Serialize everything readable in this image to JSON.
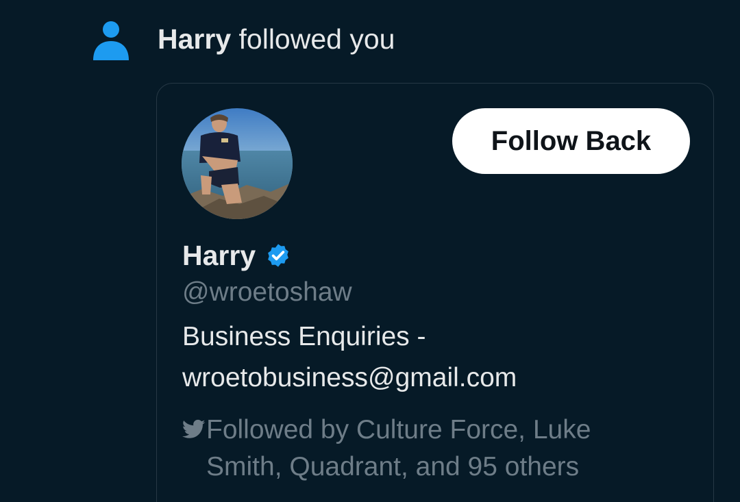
{
  "notification": {
    "actor_name": "Harry",
    "action_text": " followed you",
    "icon": "person-icon"
  },
  "user_card": {
    "display_name": "Harry",
    "verified_icon": "verified-badge-icon",
    "handle": "@wroetoshaw",
    "bio_line1": "Business Enquiries -",
    "bio_line2": "wroetobusiness@gmail.com",
    "follow_button_label": "Follow Back",
    "followed_by_line1": "Followed by Culture Force, Luke",
    "followed_by_line2": "Smith, Quadrant, and 95 others",
    "followed_by_icon": "bird-icon"
  },
  "colors": {
    "background": "#061a27",
    "accent_blue": "#1d9bf0",
    "primary_text": "#e7e9ea",
    "secondary_text": "#6e7d88",
    "button_bg": "#ffffff",
    "button_text": "#0f1419",
    "card_border": "#263845"
  }
}
